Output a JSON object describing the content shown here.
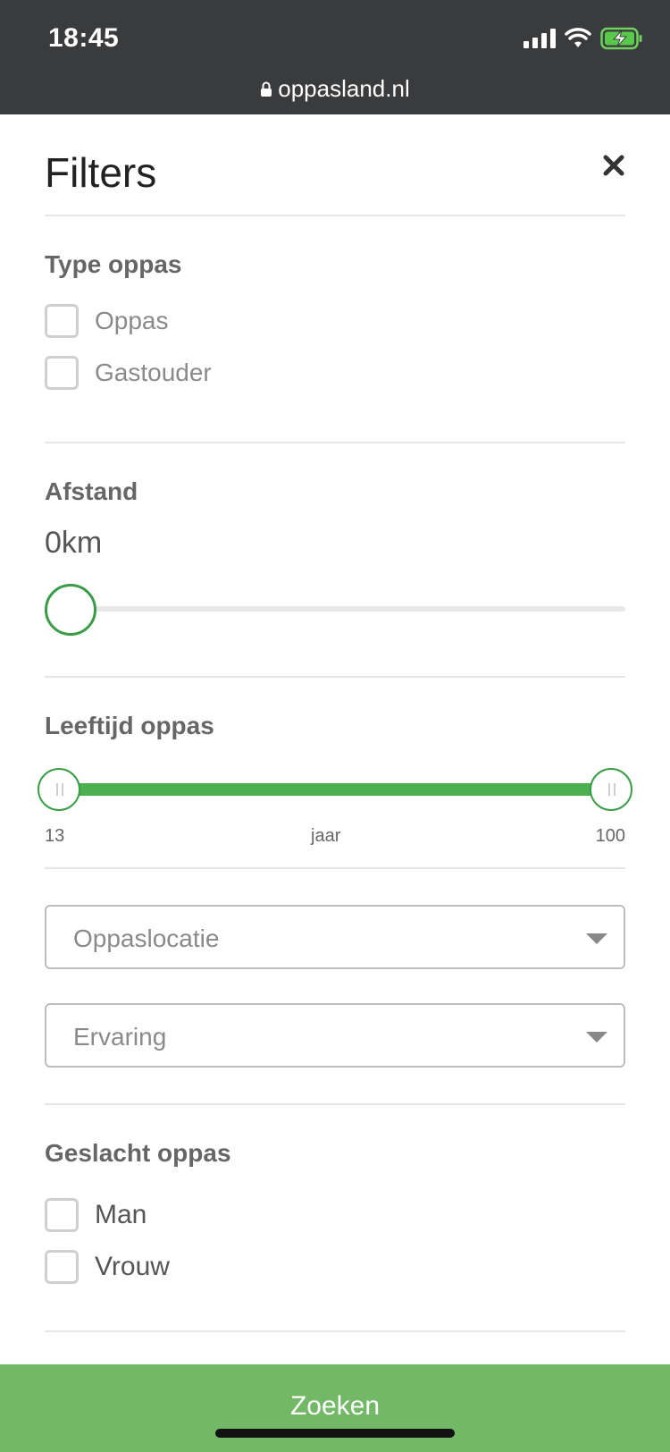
{
  "status_bar": {
    "time": "18:45",
    "icons": [
      "signal-icon",
      "wifi-icon",
      "battery-charging-icon"
    ],
    "url": "oppasland.nl"
  },
  "filters": {
    "title": "Filters",
    "close_icon": "close-icon",
    "type_section": {
      "title": "Type oppas",
      "options": [
        {
          "label": "Oppas",
          "checked": false
        },
        {
          "label": "Gastouder",
          "checked": false
        }
      ]
    },
    "distance_section": {
      "title": "Afstand",
      "value_label": "0km",
      "value": 0
    },
    "age_section": {
      "title": "Leeftijd oppas",
      "min": "13",
      "max": "100",
      "unit": "jaar",
      "selected_min": 13,
      "selected_max": 100
    },
    "selects": {
      "location_placeholder": "Oppaslocatie",
      "experience_placeholder": "Ervaring"
    },
    "gender_section": {
      "title": "Geslacht oppas",
      "options": [
        {
          "label": "Man",
          "checked": false
        },
        {
          "label": "Vrouw",
          "checked": false
        }
      ]
    },
    "search_button": "Zoeken"
  },
  "colors": {
    "accent": "#3a9c47",
    "button": "#72b866",
    "status_bar": "#3a3b3d"
  }
}
